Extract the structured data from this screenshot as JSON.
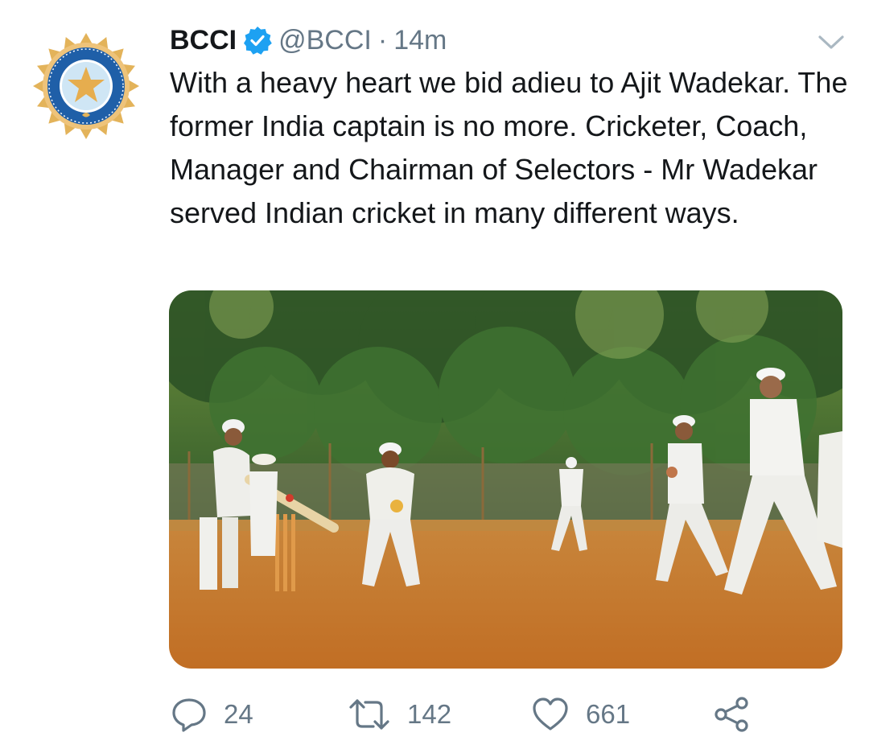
{
  "tweet": {
    "author_name": "BCCI",
    "handle": "@BCCI",
    "separator": "·",
    "time": "14m",
    "text": "With a heavy heart we bid adieu to Ajit Wadekar. The former India captain is no more. Cricketer, Coach, Manager and Chairman of Selectors - Mr Wadekar served Indian cricket in many different ways.",
    "avatar_seal_text": "BOARD OF CONTROL FOR CRICKET IN INDIA",
    "media_description": "",
    "actions": {
      "replies": "24",
      "retweets": "142",
      "likes": "661"
    }
  },
  "icons": {
    "verified": "verified-badge-icon",
    "menu": "chevron-down-icon",
    "reply": "reply-icon",
    "retweet": "retweet-icon",
    "like": "heart-icon",
    "share": "share-icon"
  },
  "colors": {
    "verified_blue": "#1da1f2",
    "secondary_text": "#657786",
    "primary_text": "#14171a",
    "logo_gold": "#e3b35a",
    "logo_blue": "#1f5fa8"
  }
}
